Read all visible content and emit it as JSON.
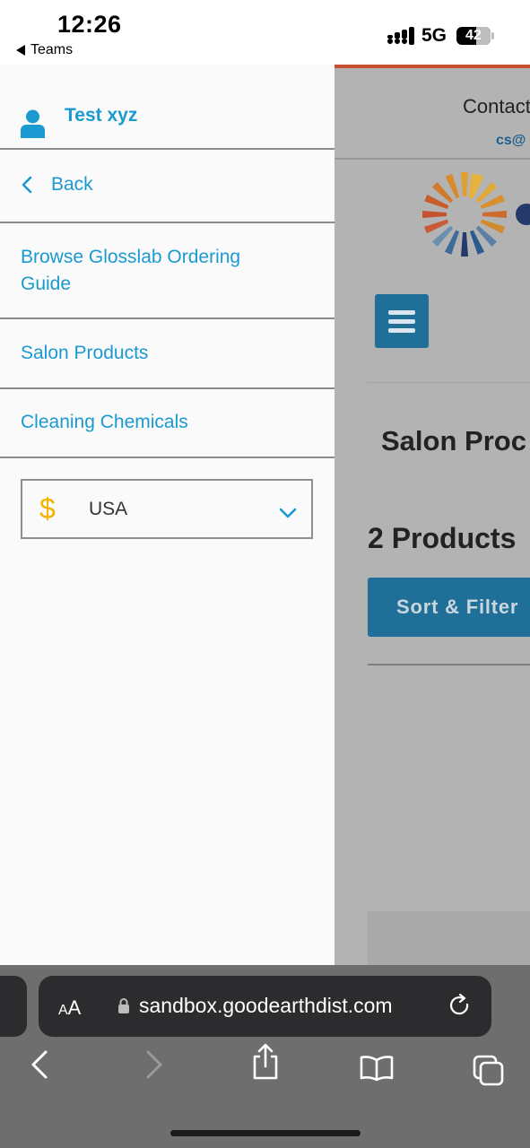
{
  "status_bar": {
    "time": "12:26",
    "back_app": "Teams",
    "network": "5G",
    "battery": "42"
  },
  "drawer": {
    "user_name": "Test xyz",
    "back_label": "Back",
    "items": [
      {
        "label": "Browse Glosslab Ordering Guide"
      },
      {
        "label": "Salon Products"
      },
      {
        "label": "Cleaning Chemicals"
      }
    ],
    "currency": {
      "symbol": "$",
      "value": "USA"
    }
  },
  "background_page": {
    "contact_text": "Contact",
    "email_text": "cs@",
    "heading": "Salon Proc",
    "product_count": "2 Products",
    "sort_filter_label": "Sort & Filter"
  },
  "browser": {
    "aa_label": "AA",
    "url": "sandbox.goodearthdist.com"
  },
  "colors": {
    "link": "#1a9ad0",
    "currency_symbol": "#f2b400",
    "brand_button": "#1f6f98",
    "accent_line": "#c9502f"
  }
}
